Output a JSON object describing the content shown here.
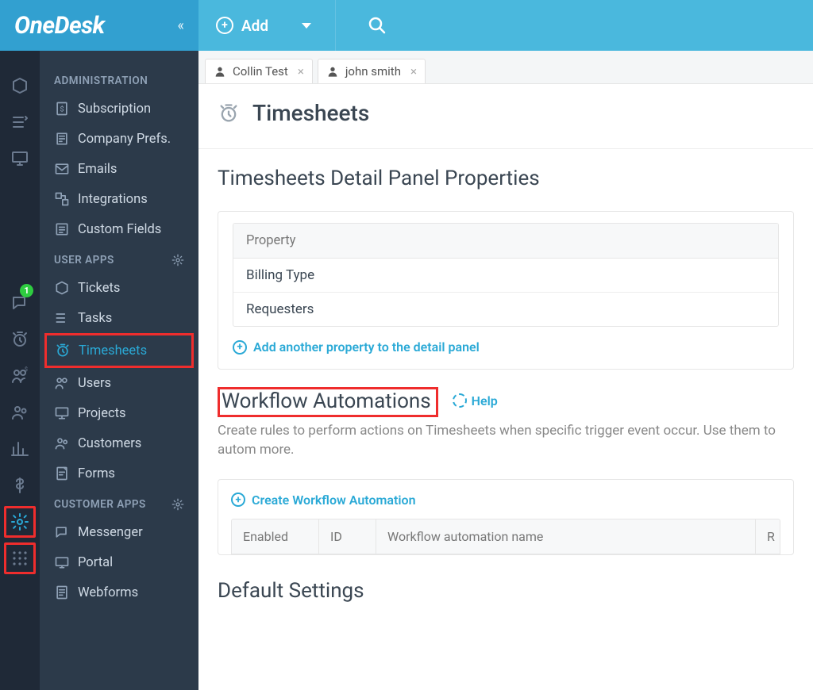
{
  "brand": "OneDesk",
  "topbar": {
    "add_label": "Add"
  },
  "rail": {
    "badge_count": "1"
  },
  "tabs": [
    {
      "label": "Collin Test"
    },
    {
      "label": "john smith"
    }
  ],
  "sidebar": {
    "sections": {
      "admin": "ADMINISTRATION",
      "user_apps": "USER APPS",
      "customer_apps": "CUSTOMER APPS"
    },
    "admin_items": [
      {
        "label": "Subscription"
      },
      {
        "label": "Company Prefs."
      },
      {
        "label": "Emails"
      },
      {
        "label": "Integrations"
      },
      {
        "label": "Custom Fields"
      }
    ],
    "user_items": [
      {
        "label": "Tickets"
      },
      {
        "label": "Tasks"
      },
      {
        "label": "Timesheets"
      },
      {
        "label": "Users"
      },
      {
        "label": "Projects"
      },
      {
        "label": "Customers"
      },
      {
        "label": "Forms"
      }
    ],
    "customer_items": [
      {
        "label": "Messenger"
      },
      {
        "label": "Portal"
      },
      {
        "label": "Webforms"
      }
    ]
  },
  "page": {
    "title": "Timesheets",
    "detail_heading": "Timesheets Detail Panel Properties",
    "property_header": "Property",
    "properties": [
      "Billing Type",
      "Requesters"
    ],
    "add_property": "Add another property to the detail panel",
    "workflow_heading": "Workflow Automations",
    "help_label": "Help",
    "workflow_desc": "Create rules to perform actions on Timesheets when specific trigger event occur. Use them to autom more.",
    "create_workflow": "Create Workflow Automation",
    "wf_cols": {
      "enabled": "Enabled",
      "id": "ID",
      "name": "Workflow automation name",
      "r": "R"
    },
    "default_heading": "Default Settings"
  }
}
